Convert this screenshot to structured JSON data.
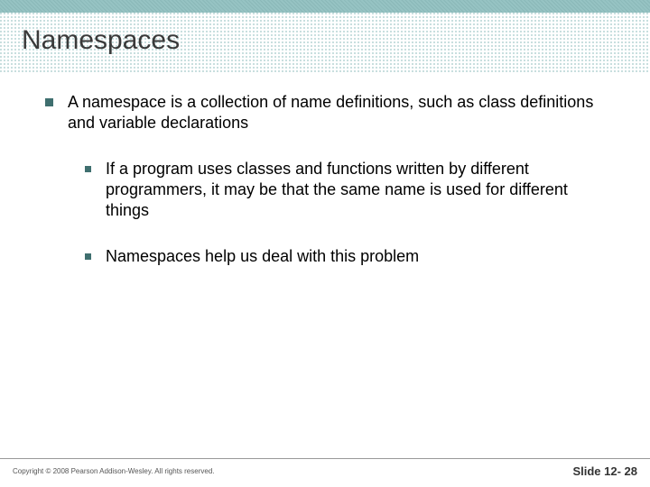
{
  "title": "Namespaces",
  "body": {
    "main_point": "A namespace is a collection of name definitions, such as class definitions and variable declarations",
    "sub_points": [
      "If a program uses classes and functions written by different programmers, it may be that the same name is used for different things",
      "Namespaces help us deal with this problem"
    ]
  },
  "footer": {
    "copyright": "Copyright © 2008 Pearson Addison-Wesley. All rights reserved.",
    "slide_label": "Slide 12- 28"
  }
}
